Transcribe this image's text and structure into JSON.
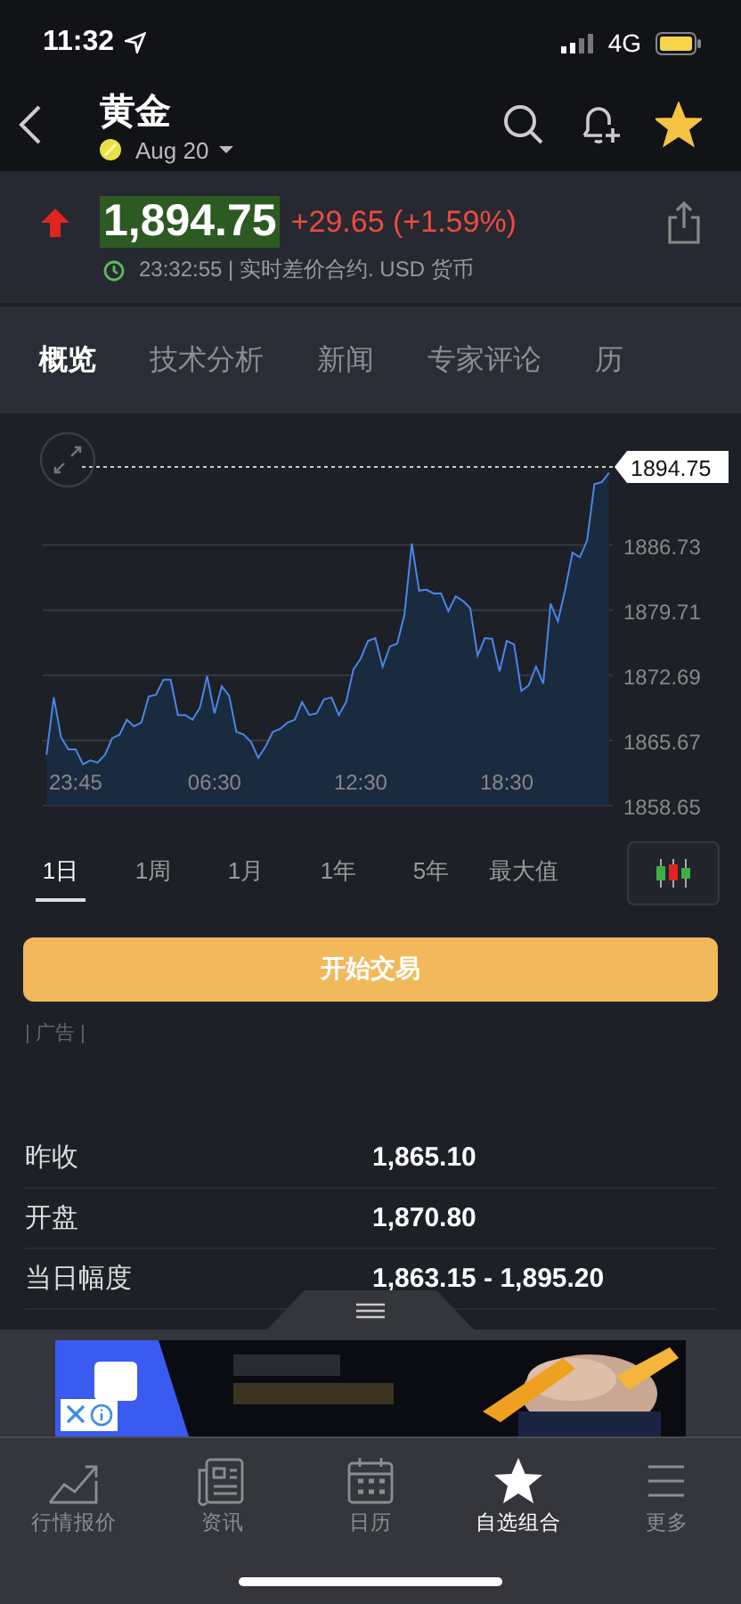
{
  "status_bar": {
    "time": "11:32",
    "network": "4G"
  },
  "header": {
    "title": "黄金",
    "contract": "Aug 20",
    "favorite": true
  },
  "quote": {
    "price": "1,894.75",
    "change": "+29.65 (+1.59%)",
    "up": true,
    "info": "23:32:55 | 实时差价合约. USD 货币"
  },
  "tabs": [
    {
      "label": "概览",
      "selected": true
    },
    {
      "label": "技术分析",
      "selected": false
    },
    {
      "label": "新闻",
      "selected": false
    },
    {
      "label": "专家评论",
      "selected": false
    },
    {
      "label": "历",
      "selected": false
    }
  ],
  "chart": {
    "chart_data": {
      "type": "area",
      "grid": true,
      "categories": [
        null,
        null,
        null,
        null,
        "23:45",
        null,
        null,
        null,
        null,
        null,
        null,
        null,
        null,
        null,
        null,
        null,
        null,
        null,
        null,
        null,
        null,
        null,
        null,
        "06:30",
        null,
        null,
        null,
        null,
        null,
        null,
        null,
        null,
        null,
        null,
        null,
        null,
        null,
        null,
        null,
        null,
        null,
        null,
        null,
        "12:30",
        null,
        null,
        null,
        null,
        null,
        null,
        null,
        null,
        null,
        null,
        null,
        null,
        null,
        null,
        null,
        null,
        null,
        null,
        null,
        "18:30",
        null,
        null,
        null,
        null,
        null,
        null,
        null,
        null,
        null,
        null,
        null,
        null,
        null,
        null
      ],
      "values": [
        1864.1,
        1870.3,
        1866.0,
        1864.7,
        1864.7,
        1863.1,
        1863.5,
        1863.3,
        1864.1,
        1865.9,
        1866.3,
        1867.9,
        1867.2,
        1867.6,
        1870.4,
        1870.6,
        1872.2,
        1872.2,
        1868.4,
        1868.4,
        1867.9,
        1869.2,
        1872.6,
        1868.6,
        1871.5,
        1870.5,
        1866.6,
        1866.3,
        1865.5,
        1863.8,
        1865.0,
        1866.6,
        1866.9,
        1867.6,
        1867.9,
        1869.8,
        1868.4,
        1868.6,
        1870.1,
        1870.3,
        1868.4,
        1869.8,
        1873.3,
        1874.5,
        1876.4,
        1876.7,
        1873.6,
        1875.8,
        1876.1,
        1879.3,
        1886.9,
        1881.8,
        1881.9,
        1881.5,
        1881.5,
        1879.6,
        1881.2,
        1880.7,
        1879.9,
        1874.8,
        1876.7,
        1876.6,
        1873.1,
        1876.4,
        1876.0,
        1871.0,
        1871.6,
        1873.6,
        1871.8,
        1880.4,
        1878.5,
        1881.9,
        1885.9,
        1885.4,
        1887.2,
        1893.3,
        1893.5,
        1894.5
      ],
      "ylim": [
        1858.65,
        1894.75
      ],
      "yticks": [
        1858.65,
        1865.67,
        1872.69,
        1879.71,
        1886.73
      ]
    },
    "price_tag": "1894.75"
  },
  "periods": [
    {
      "label": "1日",
      "selected": true
    },
    {
      "label": "1周",
      "selected": false
    },
    {
      "label": "1月",
      "selected": false
    },
    {
      "label": "1年",
      "selected": false
    },
    {
      "label": "5年",
      "selected": false
    },
    {
      "label": "最大值",
      "selected": false
    }
  ],
  "trade_button": "开始交易",
  "ad_label": "| 广告 |",
  "stats": [
    {
      "label": "昨收",
      "value": "1,865.10"
    },
    {
      "label": "开盘",
      "value": "1,870.80"
    },
    {
      "label": "当日幅度",
      "value": "1,863.15 - 1,895.20"
    }
  ],
  "nav": [
    {
      "label": "行情报价",
      "selected": false
    },
    {
      "label": "资讯",
      "selected": false
    },
    {
      "label": "日历",
      "selected": false
    },
    {
      "label": "自选组合",
      "selected": true
    },
    {
      "label": "更多",
      "selected": false
    }
  ]
}
